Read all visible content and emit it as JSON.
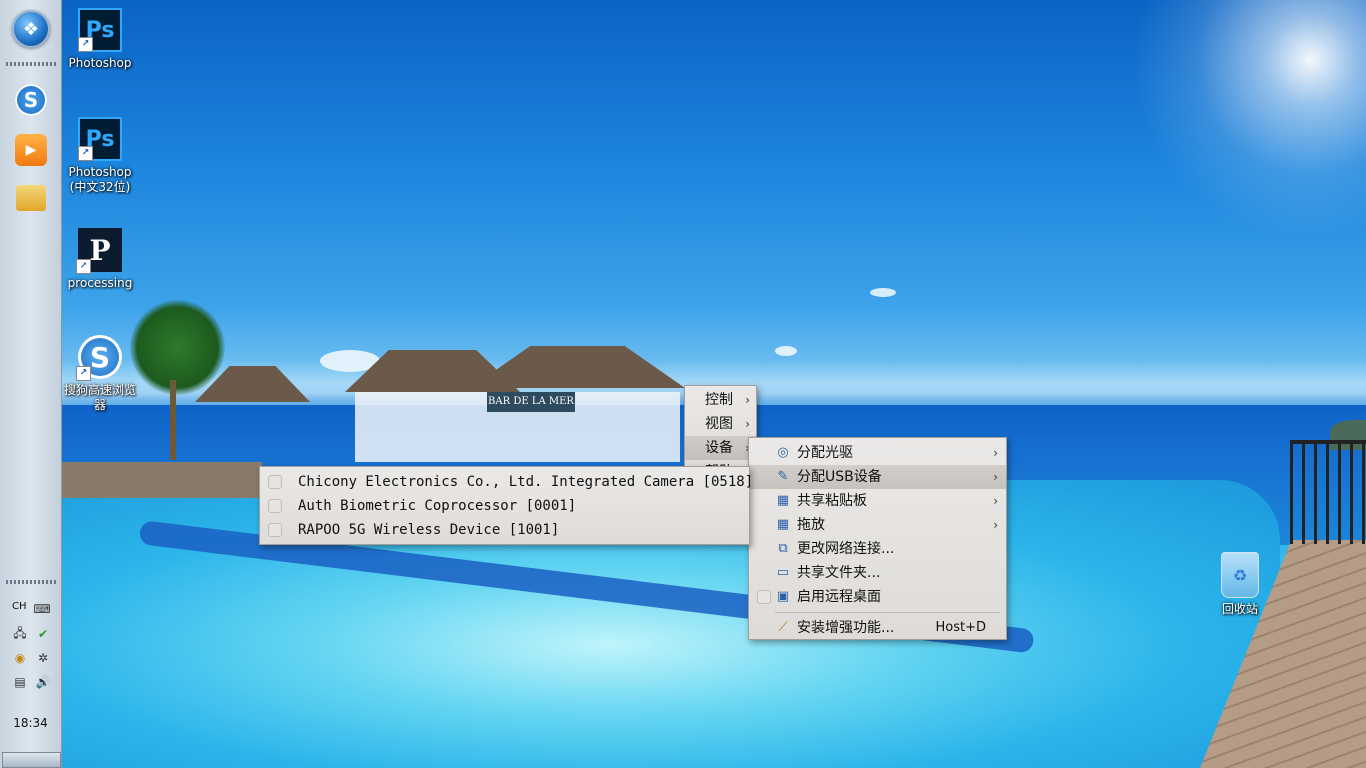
{
  "taskbar": {
    "clock": "18:34",
    "input_indicator": "CH"
  },
  "desktop_icons": [
    {
      "id": "photoshop",
      "label": "Photoshop",
      "glyph": "Ps"
    },
    {
      "id": "photoshop-cn",
      "label": "Photoshop\n(中文32位)",
      "glyph": "Ps"
    },
    {
      "id": "processing",
      "label": "processing",
      "glyph": "P"
    },
    {
      "id": "sogou",
      "label": "搜狗高速浏览器",
      "glyph": "S"
    },
    {
      "id": "recycle-bin",
      "label": "回收站",
      "glyph": "♻"
    }
  ],
  "menu_top": {
    "items": [
      {
        "label": "控制",
        "arrow": "›"
      },
      {
        "label": "视图",
        "arrow": "›"
      },
      {
        "label": "设备",
        "arrow": "›"
      },
      {
        "label": "帮助",
        "arrow": "›"
      }
    ]
  },
  "menu_devices": {
    "items": [
      {
        "label": "分配光驱",
        "icon": "disc-icon",
        "has_arrow": true
      },
      {
        "label": "分配USB设备",
        "icon": "usb-icon",
        "has_arrow": true
      },
      {
        "label": "共享粘贴板",
        "icon": "clipboard-icon",
        "has_arrow": true
      },
      {
        "label": "拖放",
        "icon": "drag-drop-icon",
        "has_arrow": true
      },
      {
        "label": "更改网络连接...",
        "icon": "network-icon",
        "has_arrow": false
      },
      {
        "label": "共享文件夹...",
        "icon": "shared-folder-icon",
        "has_arrow": false
      },
      {
        "label": "启用远程桌面",
        "icon": "remote-desktop-icon",
        "has_arrow": false
      },
      {
        "label": "安装增强功能...",
        "icon": "wrench-icon",
        "has_arrow": false,
        "shortcut": "Host+D"
      }
    ]
  },
  "menu_usb": {
    "items": [
      {
        "label": "Chicony Electronics Co., Ltd. Integrated Camera [0518]"
      },
      {
        "label": "Auth Biometric Coprocessor [0001]"
      },
      {
        "label": "RAPOO 5G Wireless Device [1001]"
      }
    ]
  }
}
